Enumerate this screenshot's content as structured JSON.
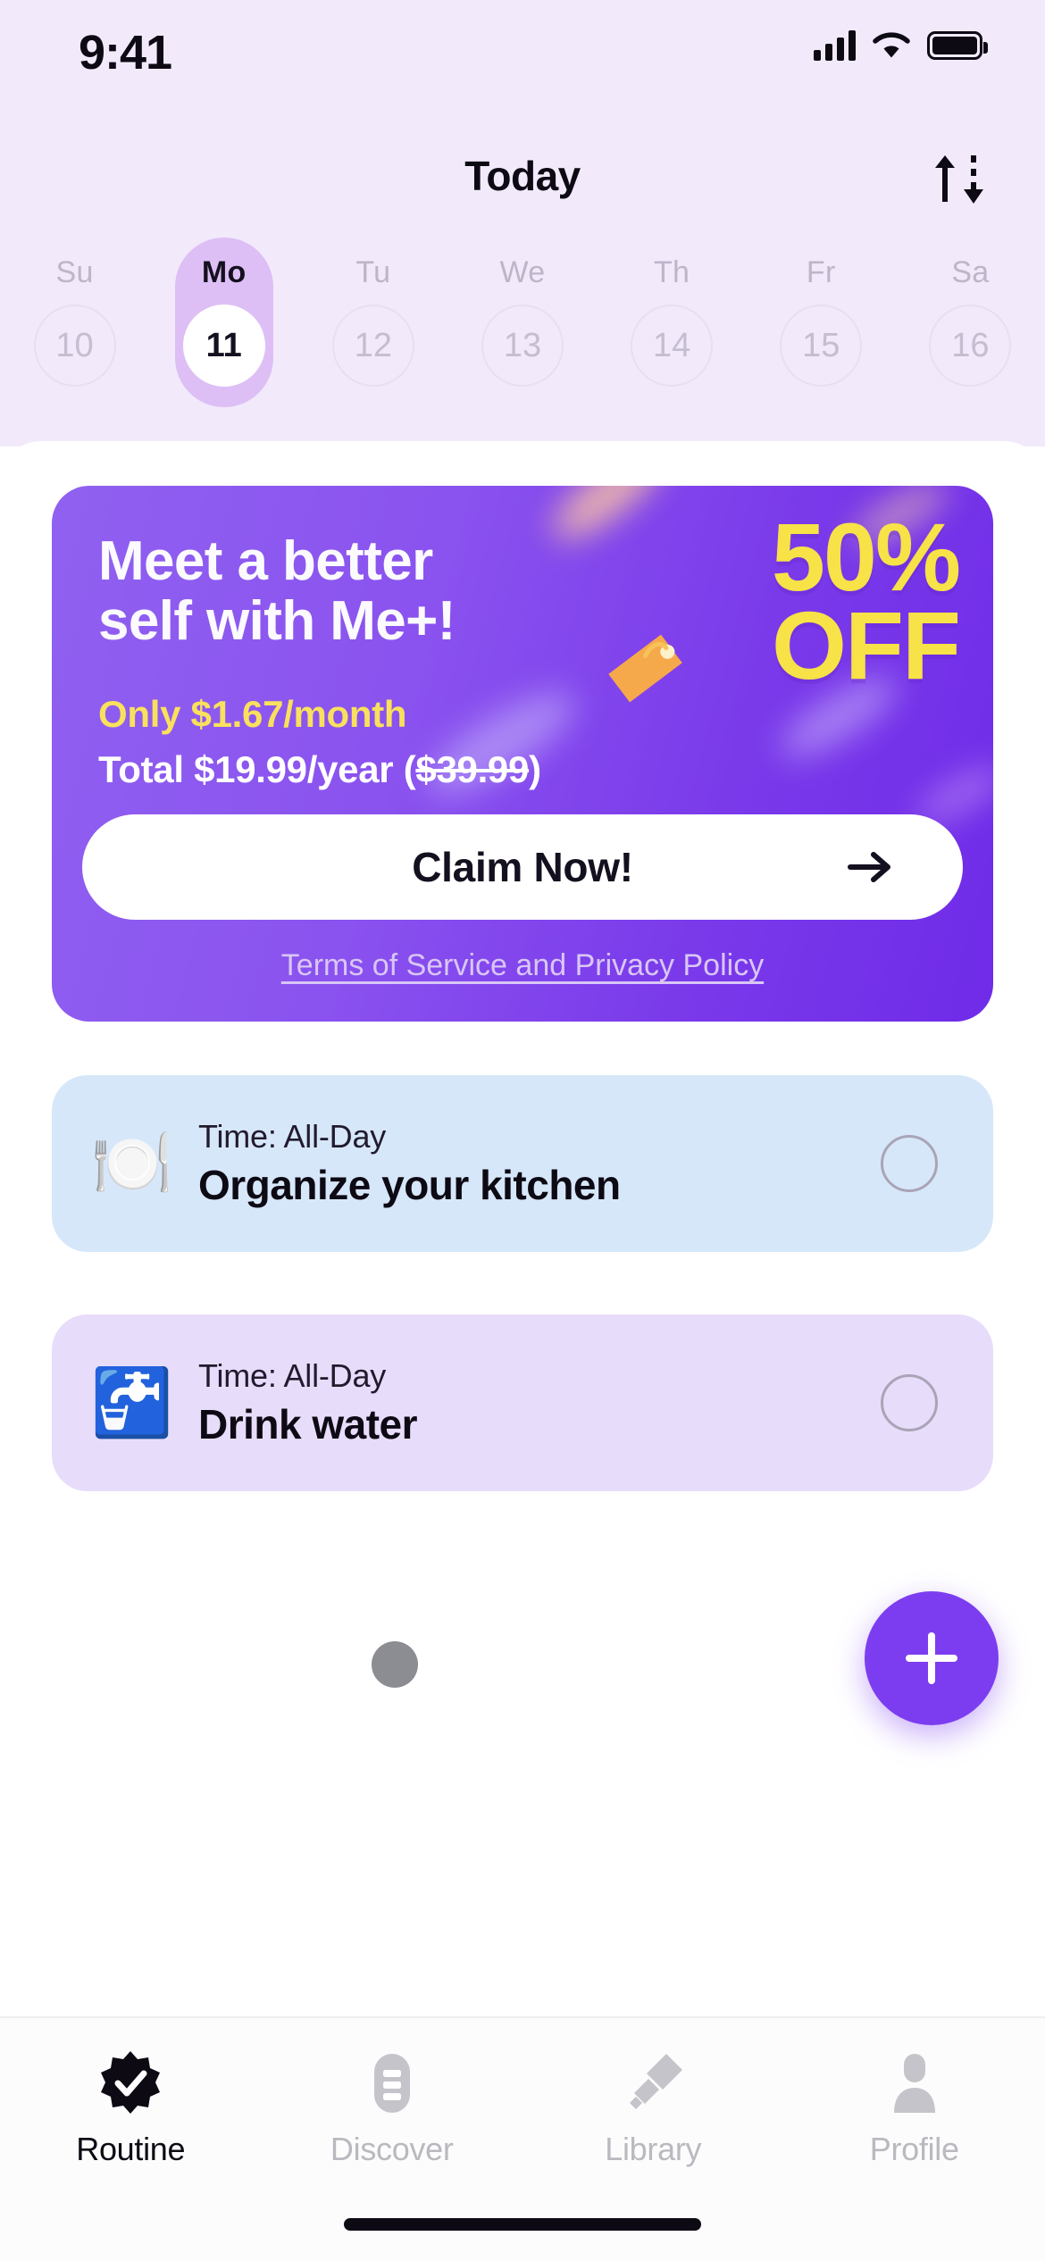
{
  "status_bar": {
    "time": "9:41",
    "signal_icon": "cellular-signal-icon",
    "wifi_icon": "wifi-icon",
    "battery_icon": "battery-icon"
  },
  "header": {
    "title": "Today",
    "sort_icon": "sort-arrows-icon"
  },
  "calendar": {
    "days": [
      {
        "name": "Su",
        "number": "10",
        "selected": false
      },
      {
        "name": "Mo",
        "number": "11",
        "selected": true
      },
      {
        "name": "Tu",
        "number": "12",
        "selected": false
      },
      {
        "name": "We",
        "number": "13",
        "selected": false
      },
      {
        "name": "Th",
        "number": "14",
        "selected": false
      },
      {
        "name": "Fr",
        "number": "15",
        "selected": false
      },
      {
        "name": "Sa",
        "number": "16",
        "selected": false
      }
    ]
  },
  "promo": {
    "headline_line1": "Meet a better",
    "headline_line2": "self with Me+!",
    "monthly_price": "Only $1.67/month",
    "total_prefix": "Total $19.99/year (",
    "total_old_price": "$39.99",
    "total_suffix": ")",
    "discount_line1": "50%",
    "discount_line2": "OFF",
    "cta_label": "Claim Now!",
    "cta_arrow_icon": "arrow-right-icon",
    "price_tag_icon": "price-tag-icon",
    "terms_label": "Terms of Service and Privacy Policy",
    "accent_yellow": "#f7e247",
    "background_purple": "#7a3aea"
  },
  "tasks": [
    {
      "emoji": "🍽️",
      "emoji_name": "fork-and-knife-with-plate-icon",
      "time": "Time: All-Day",
      "title": "Organize your kitchen",
      "completed": false,
      "card_color": "#d7e7fa"
    },
    {
      "emoji": "🚰",
      "emoji_name": "potable-water-icon",
      "time": "Time: All-Day",
      "title": "Drink water",
      "completed": false,
      "card_color": "#e8dcfb"
    }
  ],
  "fab": {
    "icon": "plus-icon",
    "color": "#7c3df0"
  },
  "tabbar": {
    "tabs": [
      {
        "label": "Routine",
        "icon": "verified-check-badge-icon",
        "active": true
      },
      {
        "label": "Discover",
        "icon": "list-capsule-icon",
        "active": false
      },
      {
        "label": "Library",
        "icon": "bookmark-diamonds-icon",
        "active": false
      },
      {
        "label": "Profile",
        "icon": "person-icon",
        "active": false
      }
    ]
  }
}
